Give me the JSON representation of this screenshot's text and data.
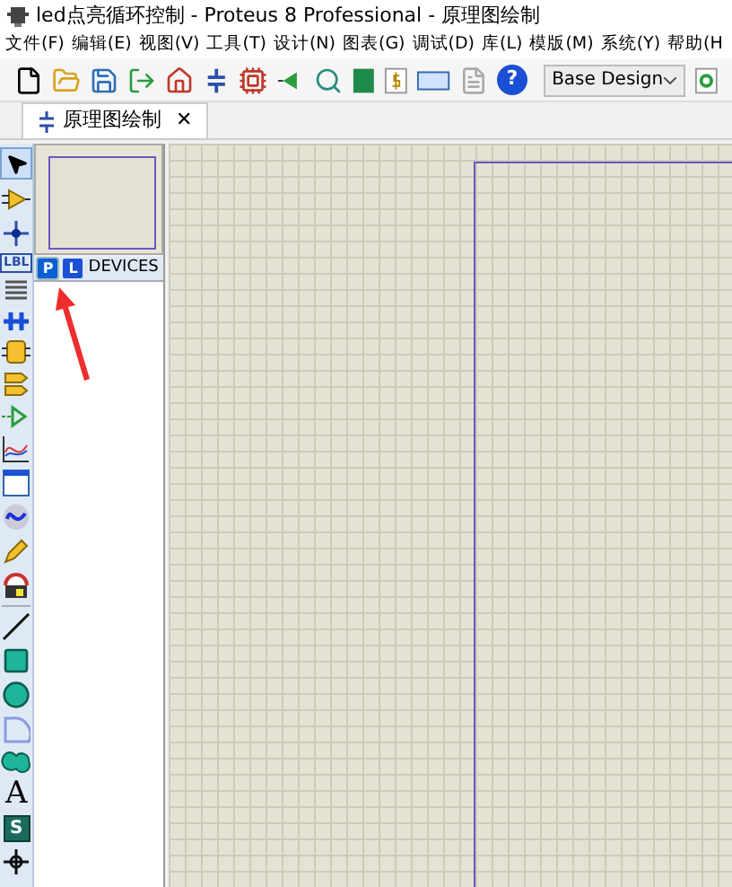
{
  "window": {
    "title": "led点亮循环控制 - Proteus 8 Professional - 原理图绘制"
  },
  "menu": [
    "文件(F)",
    "编辑(E)",
    "视图(V)",
    "工具(T)",
    "设计(N)",
    "图表(G)",
    "调试(D)",
    "库(L)",
    "模版(M)",
    "系统(Y)",
    "帮助(H"
  ],
  "toolbar": {
    "design_select": "Base Design",
    "help": "?"
  },
  "tabs": [
    {
      "label": "原理图绘制",
      "selected": true,
      "close": "✕"
    }
  ],
  "left_tools": {
    "label_tool": "LBL",
    "text_tool": "A",
    "symbol_tool": "S"
  },
  "selector": {
    "buttons": [
      {
        "label": "P",
        "selected": true
      },
      {
        "label": "L",
        "selected": false
      }
    ],
    "header": "DEVICES"
  }
}
